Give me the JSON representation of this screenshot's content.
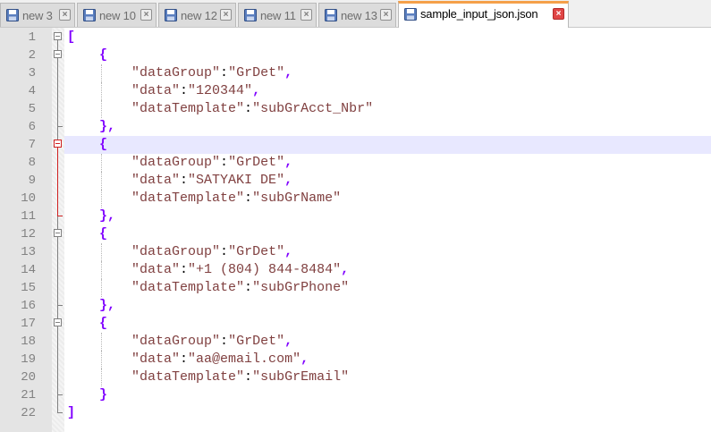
{
  "tabs": [
    {
      "label": "new 3",
      "active": false
    },
    {
      "label": "new 10",
      "active": false
    },
    {
      "label": "new 12",
      "active": false
    },
    {
      "label": "new 11",
      "active": false
    },
    {
      "label": "new 13",
      "active": false
    },
    {
      "label": "sample_input_json.json",
      "active": true
    }
  ],
  "icons": {
    "tab_file": "save-disk-icon",
    "tab_close": "close-icon",
    "fold": "fold-toggle-icon"
  },
  "colors": {
    "tab_accent": "#f5a04a",
    "active_close": "#e04545",
    "string": "#804040",
    "punctuation": "#8000ff",
    "current_line": "#e8e8ff",
    "active_fold": "#d02020"
  },
  "editor": {
    "current_line": 7,
    "lines": [
      {
        "n": "1",
        "tokens": [
          {
            "t": "[",
            "k": "pun"
          }
        ]
      },
      {
        "n": "2",
        "tokens": [
          {
            "t": "    "
          },
          {
            "t": "{",
            "k": "pun"
          }
        ]
      },
      {
        "n": "3",
        "tokens": [
          {
            "t": "        "
          },
          {
            "t": "\"dataGroup\"",
            "k": "str"
          },
          {
            "t": ":",
            "k": "op"
          },
          {
            "t": "\"GrDet\"",
            "k": "str"
          },
          {
            "t": ",",
            "k": "pun"
          }
        ]
      },
      {
        "n": "4",
        "tokens": [
          {
            "t": "        "
          },
          {
            "t": "\"data\"",
            "k": "str"
          },
          {
            "t": ":",
            "k": "op"
          },
          {
            "t": "\"120344\"",
            "k": "str"
          },
          {
            "t": ",",
            "k": "pun"
          }
        ]
      },
      {
        "n": "5",
        "tokens": [
          {
            "t": "        "
          },
          {
            "t": "\"dataTemplate\"",
            "k": "str"
          },
          {
            "t": ":",
            "k": "op"
          },
          {
            "t": "\"subGrAcct_Nbr\"",
            "k": "str"
          }
        ]
      },
      {
        "n": "6",
        "tokens": [
          {
            "t": "    "
          },
          {
            "t": "},",
            "k": "pun"
          }
        ]
      },
      {
        "n": "7",
        "tokens": [
          {
            "t": "    "
          },
          {
            "t": "{",
            "k": "pun"
          }
        ]
      },
      {
        "n": "8",
        "tokens": [
          {
            "t": "        "
          },
          {
            "t": "\"dataGroup\"",
            "k": "str"
          },
          {
            "t": ":",
            "k": "op"
          },
          {
            "t": "\"GrDet\"",
            "k": "str"
          },
          {
            "t": ",",
            "k": "pun"
          }
        ]
      },
      {
        "n": "9",
        "tokens": [
          {
            "t": "        "
          },
          {
            "t": "\"data\"",
            "k": "str"
          },
          {
            "t": ":",
            "k": "op"
          },
          {
            "t": "\"SATYAKI DE\"",
            "k": "str"
          },
          {
            "t": ",",
            "k": "pun"
          }
        ]
      },
      {
        "n": "10",
        "tokens": [
          {
            "t": "        "
          },
          {
            "t": "\"dataTemplate\"",
            "k": "str"
          },
          {
            "t": ":",
            "k": "op"
          },
          {
            "t": "\"subGrName\"",
            "k": "str"
          }
        ]
      },
      {
        "n": "11",
        "tokens": [
          {
            "t": "    "
          },
          {
            "t": "},",
            "k": "pun"
          }
        ]
      },
      {
        "n": "12",
        "tokens": [
          {
            "t": "    "
          },
          {
            "t": "{",
            "k": "pun"
          }
        ]
      },
      {
        "n": "13",
        "tokens": [
          {
            "t": "        "
          },
          {
            "t": "\"dataGroup\"",
            "k": "str"
          },
          {
            "t": ":",
            "k": "op"
          },
          {
            "t": "\"GrDet\"",
            "k": "str"
          },
          {
            "t": ",",
            "k": "pun"
          }
        ]
      },
      {
        "n": "14",
        "tokens": [
          {
            "t": "        "
          },
          {
            "t": "\"data\"",
            "k": "str"
          },
          {
            "t": ":",
            "k": "op"
          },
          {
            "t": "\"+1 (804) 844-8484\"",
            "k": "str"
          },
          {
            "t": ",",
            "k": "pun"
          }
        ]
      },
      {
        "n": "15",
        "tokens": [
          {
            "t": "        "
          },
          {
            "t": "\"dataTemplate\"",
            "k": "str"
          },
          {
            "t": ":",
            "k": "op"
          },
          {
            "t": "\"subGrPhone\"",
            "k": "str"
          }
        ]
      },
      {
        "n": "16",
        "tokens": [
          {
            "t": "    "
          },
          {
            "t": "},",
            "k": "pun"
          }
        ]
      },
      {
        "n": "17",
        "tokens": [
          {
            "t": "    "
          },
          {
            "t": "{",
            "k": "pun"
          }
        ]
      },
      {
        "n": "18",
        "tokens": [
          {
            "t": "        "
          },
          {
            "t": "\"dataGroup\"",
            "k": "str"
          },
          {
            "t": ":",
            "k": "op"
          },
          {
            "t": "\"GrDet\"",
            "k": "str"
          },
          {
            "t": ",",
            "k": "pun"
          }
        ]
      },
      {
        "n": "19",
        "tokens": [
          {
            "t": "        "
          },
          {
            "t": "\"data\"",
            "k": "str"
          },
          {
            "t": ":",
            "k": "op"
          },
          {
            "t": "\"aa@email.com\"",
            "k": "str"
          },
          {
            "t": ",",
            "k": "pun"
          }
        ]
      },
      {
        "n": "20",
        "tokens": [
          {
            "t": "        "
          },
          {
            "t": "\"dataTemplate\"",
            "k": "str"
          },
          {
            "t": ":",
            "k": "op"
          },
          {
            "t": "\"subGrEmail\"",
            "k": "str"
          }
        ]
      },
      {
        "n": "21",
        "tokens": [
          {
            "t": "    "
          },
          {
            "t": "}",
            "k": "pun"
          }
        ]
      },
      {
        "n": "22",
        "tokens": [
          {
            "t": "]",
            "k": "pun"
          }
        ]
      }
    ]
  }
}
